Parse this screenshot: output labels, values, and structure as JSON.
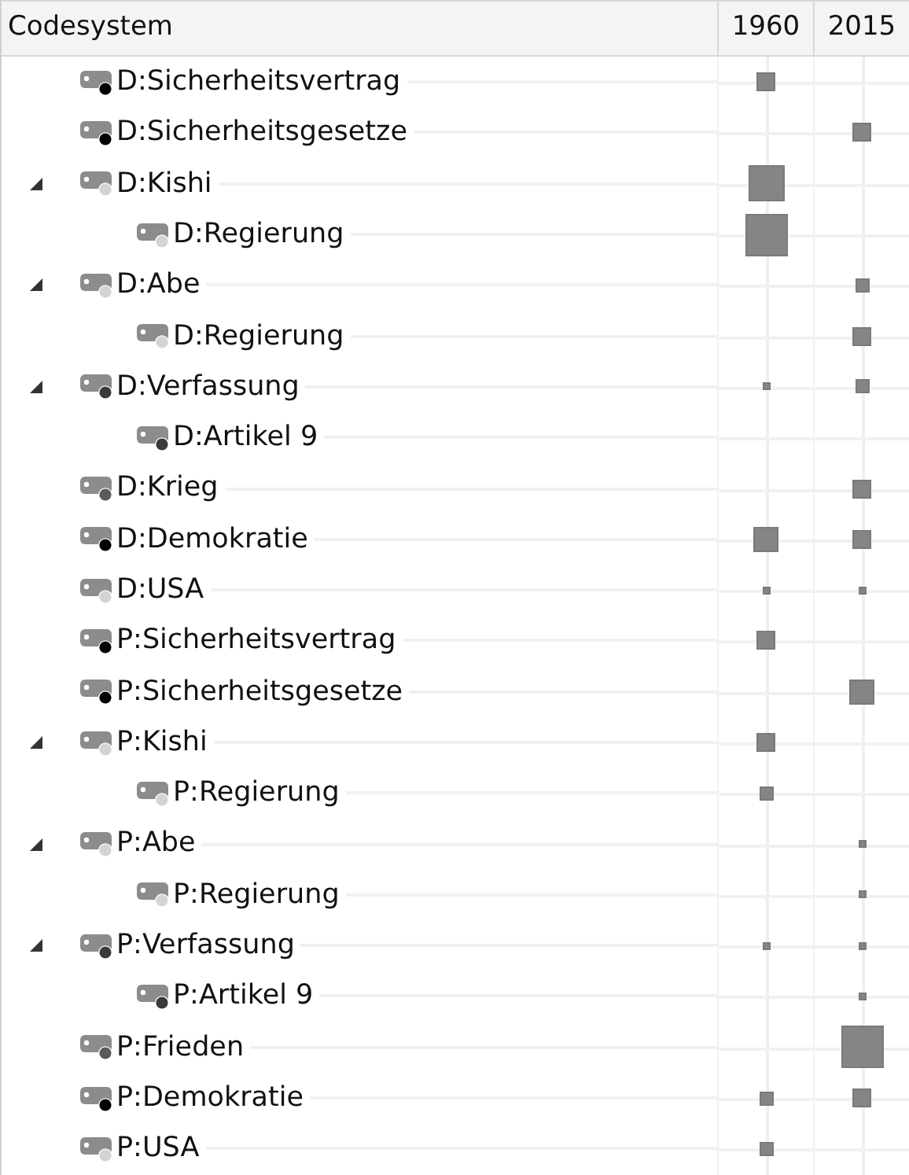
{
  "columns": [
    "Codesystem",
    "1960",
    "2015"
  ],
  "codes": [
    {
      "label": "D:Sicherheitsvertrag",
      "color": "#000000",
      "cells": [
        {
          "kind": "medium"
        },
        null
      ]
    },
    {
      "label": "D:Sicherheitsgesetze",
      "color": "#000000",
      "cells": [
        null,
        {
          "kind": "medium"
        }
      ]
    },
    {
      "label": "D:Kishi",
      "color": "#d4d4d4",
      "expanded": true,
      "cells": [
        {
          "kind": "big"
        },
        null
      ],
      "children": [
        {
          "label": "D:Regierung",
          "color": "#d4d4d4",
          "cells": [
            {
              "kind": "huge"
            },
            null
          ]
        }
      ]
    },
    {
      "label": "D:Abe",
      "color": "#d4d4d4",
      "expanded": true,
      "cells": [
        null,
        {
          "kind": "small"
        }
      ],
      "children": [
        {
          "label": "D:Regierung",
          "color": "#d4d4d4",
          "cells": [
            null,
            {
              "kind": "medium"
            }
          ]
        }
      ]
    },
    {
      "label": "D:Verfassung",
      "color": "#3a3a3a",
      "expanded": true,
      "cells": [
        {
          "kind": "tiny"
        },
        {
          "kind": "small"
        }
      ],
      "children": [
        {
          "label": "D:Artikel 9",
          "color": "#3a3a3a",
          "cells": [
            null,
            null
          ]
        }
      ]
    },
    {
      "label": "D:Krieg",
      "color": "#5a5a5a",
      "cells": [
        null,
        {
          "kind": "medium"
        }
      ]
    },
    {
      "label": "D:Demokratie",
      "color": "#000000",
      "cells": [
        {
          "kind": "large"
        },
        {
          "kind": "medium"
        }
      ]
    },
    {
      "label": "D:USA",
      "color": "#d4d4d4",
      "cells": [
        {
          "kind": "tiny"
        },
        {
          "kind": "tiny"
        }
      ]
    },
    {
      "label": "P:Sicherheitsvertrag",
      "color": "#000000",
      "cells": [
        {
          "kind": "medium"
        },
        null
      ]
    },
    {
      "label": "P:Sicherheitsgesetze",
      "color": "#000000",
      "cells": [
        null,
        {
          "kind": "large"
        }
      ]
    },
    {
      "label": "P:Kishi",
      "color": "#d4d4d4",
      "expanded": true,
      "cells": [
        {
          "kind": "medium"
        },
        null
      ],
      "children": [
        {
          "label": "P:Regierung",
          "color": "#d4d4d4",
          "cells": [
            {
              "kind": "small"
            },
            null
          ]
        }
      ]
    },
    {
      "label": "P:Abe",
      "color": "#d4d4d4",
      "expanded": true,
      "cells": [
        null,
        {
          "kind": "tiny"
        }
      ],
      "children": [
        {
          "label": "P:Regierung",
          "color": "#d4d4d4",
          "cells": [
            null,
            {
              "kind": "tiny"
            }
          ]
        }
      ]
    },
    {
      "label": "P:Verfassung",
      "color": "#3a3a3a",
      "expanded": true,
      "cells": [
        {
          "kind": "tiny"
        },
        {
          "kind": "tiny"
        }
      ],
      "children": [
        {
          "label": "P:Artikel 9",
          "color": "#3a3a3a",
          "cells": [
            null,
            {
              "kind": "tiny"
            }
          ]
        }
      ]
    },
    {
      "label": "P:Frieden",
      "color": "#5a5a5a",
      "cells": [
        null,
        {
          "kind": "huge"
        }
      ]
    },
    {
      "label": "P:Demokratie",
      "color": "#000000",
      "cells": [
        {
          "kind": "small"
        },
        {
          "kind": "medium"
        }
      ]
    },
    {
      "label": "P:USA",
      "color": "#d4d4d4",
      "cells": [
        {
          "kind": "small"
        },
        null
      ]
    }
  ]
}
